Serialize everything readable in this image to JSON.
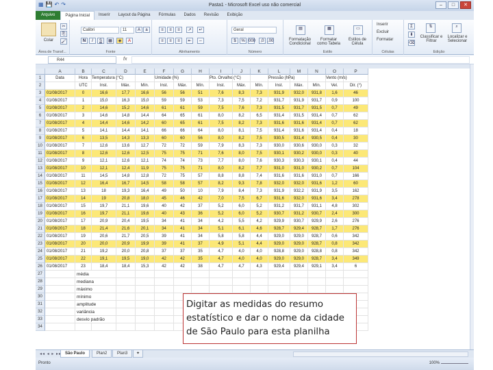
{
  "window": {
    "title": "Pasta1 - Microsoft Excel uso não comercial",
    "controls": [
      "–",
      "□",
      "✕"
    ]
  },
  "ribbon_tabs": [
    "Arquivo",
    "Página Inicial",
    "Inserir",
    "Layout da Página",
    "Fórmulas",
    "Dados",
    "Revisão",
    "Exibição"
  ],
  "ribbon": {
    "paste_label": "Colar",
    "font_name": "Calibri",
    "font_size": "11",
    "number_format": "Geral",
    "groups": [
      "Área de Transf...",
      "Fonte",
      "Alinhamento",
      "Número",
      "Estilo",
      "Células",
      "Edição"
    ],
    "style_buttons": [
      "Formatação Condicional",
      "Formatar como Tabela",
      "Estilos de Célula"
    ],
    "cell_buttons": [
      "Inserir",
      "Excluir",
      "Formatar"
    ],
    "edit_buttons": [
      "Classificar e Filtrar",
      "Localizar e Selecionar"
    ]
  },
  "formula_bar": {
    "name_box": "R44",
    "fx": "fx",
    "value": ""
  },
  "columns": [
    "A",
    "B",
    "C",
    "D",
    "E",
    "F",
    "G",
    "H",
    "I",
    "J",
    "K",
    "L",
    "M",
    "N",
    "O",
    "P"
  ],
  "header_row1": {
    "A": "Data",
    "B": "Hora",
    "C": "Temperatura (°C)",
    "F": "Umidade (%)",
    "I": "Pto. Orvalho (°C)",
    "L": "Pressão (hPa)",
    "O": "Vento (m/s)"
  },
  "header_row2": [
    "",
    "UTC",
    "Inst.",
    "Máx.",
    "Mín.",
    "Inst.",
    "Máx.",
    "Mín.",
    "Inst.",
    "Máx.",
    "Mín.",
    "Inst.",
    "Máx.",
    "Mín.",
    "Vel.",
    "Dir. (°)"
  ],
  "data_rows": [
    [
      "01/08/2017",
      "0",
      "16,6",
      "17,7",
      "16,6",
      "56",
      "56",
      "51",
      "7,6",
      "8,3",
      "7,3",
      "931,9",
      "932,0",
      "931,8",
      "1,6",
      "46"
    ],
    [
      "01/08/2017",
      "1",
      "15,0",
      "16,3",
      "15,0",
      "59",
      "59",
      "53",
      "7,3",
      "7,5",
      "7,2",
      "931,7",
      "931,9",
      "931,7",
      "0,9",
      "100"
    ],
    [
      "01/08/2017",
      "2",
      "14,6",
      "15,2",
      "14,6",
      "61",
      "61",
      "59",
      "7,5",
      "7,6",
      "7,3",
      "931,5",
      "931,7",
      "931,5",
      "0,7",
      "49"
    ],
    [
      "01/08/2017",
      "3",
      "14,6",
      "14,8",
      "14,4",
      "64",
      "65",
      "61",
      "8,0",
      "8,2",
      "6,5",
      "931,4",
      "931,5",
      "931,4",
      "0,7",
      "62"
    ],
    [
      "01/08/2017",
      "4",
      "14,4",
      "14,6",
      "14,2",
      "60",
      "65",
      "61",
      "7,5",
      "8,2",
      "7,3",
      "931,6",
      "931,6",
      "931,4",
      "0,7",
      "62"
    ],
    [
      "01/08/2017",
      "5",
      "14,1",
      "14,4",
      "14,1",
      "66",
      "66",
      "64",
      "8,0",
      "8,1",
      "7,5",
      "931,4",
      "931,6",
      "931,4",
      "0,4",
      "18"
    ],
    [
      "01/08/2017",
      "6",
      "13,5",
      "14,3",
      "13,3",
      "60",
      "60",
      "56",
      "8,0",
      "8,2",
      "7,5",
      "930,5",
      "931,4",
      "930,5",
      "0,4",
      "30"
    ],
    [
      "01/08/2017",
      "7",
      "12,6",
      "13,6",
      "12,7",
      "72",
      "72",
      "59",
      "7,9",
      "8,3",
      "7,3",
      "930,0",
      "930,6",
      "930,0",
      "0,3",
      "32"
    ],
    [
      "01/08/2017",
      "8",
      "12,6",
      "12,6",
      "12,5",
      "75",
      "75",
      "71",
      "7,6",
      "8,0",
      "7,5",
      "930,1",
      "930,2",
      "930,0",
      "0,3",
      "40"
    ],
    [
      "01/08/2017",
      "9",
      "12,1",
      "12,6",
      "12,1",
      "74",
      "74",
      "73",
      "7,7",
      "8,0",
      "7,6",
      "930,3",
      "930,3",
      "930,1",
      "0,4",
      "44"
    ],
    [
      "01/08/2017",
      "10",
      "12,1",
      "12,4",
      "11,9",
      "75",
      "75",
      "71",
      "8,0",
      "8,2",
      "7,7",
      "931,0",
      "931,0",
      "930,2",
      "0,7",
      "104"
    ],
    [
      "01/08/2017",
      "11",
      "14,5",
      "14,8",
      "12,8",
      "72",
      "75",
      "57",
      "8,8",
      "8,8",
      "7,4",
      "931,6",
      "931,6",
      "931,0",
      "0,7",
      "166"
    ],
    [
      "01/08/2017",
      "12",
      "16,4",
      "16,7",
      "14,5",
      "58",
      "58",
      "57",
      "8,2",
      "9,3",
      "7,8",
      "932,0",
      "932,0",
      "931,6",
      "1,2",
      "60"
    ],
    [
      "01/08/2017",
      "13",
      "18",
      "19,3",
      "16,4",
      "49",
      "50",
      "10",
      "7,9",
      "8,4",
      "7,3",
      "931,9",
      "932,2",
      "931,9",
      "3,5",
      "162"
    ],
    [
      "01/08/2017",
      "14",
      "19",
      "20,8",
      "18,0",
      "45",
      "46",
      "42",
      "7,0",
      "7,5",
      "6,7",
      "931,6",
      "932,0",
      "931,6",
      "3,4",
      "278"
    ],
    [
      "01/08/2017",
      "15",
      "19,7",
      "21,1",
      "19,6",
      "40",
      "42",
      "37",
      "5,2",
      "6,0",
      "5,2",
      "931,2",
      "931,7",
      "931,1",
      "4,8",
      "302"
    ],
    [
      "01/08/2017",
      "16",
      "19,7",
      "21,1",
      "19,6",
      "40",
      "43",
      "36",
      "5,2",
      "6,0",
      "5,2",
      "930,7",
      "931,2",
      "930,7",
      "2,4",
      "300"
    ],
    [
      "01/08/2017",
      "17",
      "20,9",
      "20,4",
      "19,5",
      "34",
      "41",
      "34",
      "4,2",
      "5,5",
      "4,2",
      "929,9",
      "930,7",
      "929,9",
      "2,6",
      "276"
    ],
    [
      "01/08/2017",
      "18",
      "21,4",
      "21,6",
      "20,1",
      "34",
      "41",
      "34",
      "5,1",
      "6,1",
      "4,6",
      "928,7",
      "929,4",
      "928,7",
      "1,7",
      "276"
    ],
    [
      "01/08/2017",
      "19",
      "20,6",
      "21,7",
      "20,5",
      "39",
      "41",
      "34",
      "5,8",
      "5,8",
      "4,4",
      "929,0",
      "929,0",
      "928,7",
      "0,6",
      "342"
    ],
    [
      "01/08/2017",
      "20",
      "20,0",
      "20,9",
      "19,9",
      "39",
      "41",
      "37",
      "4,9",
      "5,1",
      "4,4",
      "929,0",
      "929,0",
      "928,7",
      "0,8",
      "342"
    ],
    [
      "01/08/2017",
      "21",
      "19,2",
      "20,0",
      "20,8",
      "37",
      "37",
      "35",
      "4,7",
      "4,0",
      "4,0",
      "928,8",
      "929,0",
      "928,8",
      "0,8",
      "342"
    ],
    [
      "01/08/2017",
      "22",
      "19,1",
      "19,5",
      "19,0",
      "42",
      "42",
      "35",
      "4,7",
      "4,0",
      "4,0",
      "929,0",
      "929,0",
      "928,7",
      "3,4",
      "349"
    ],
    [
      "01/08/2017",
      "23",
      "18,4",
      "18,4",
      "15,3",
      "42",
      "42",
      "38",
      "4,7",
      "4,7",
      "4,3",
      "929,4",
      "929,4",
      "929,1",
      "3,4",
      "6"
    ]
  ],
  "stat_labels": [
    "média",
    "mediana",
    "máximo",
    "mínimo",
    "amplitude",
    "variância",
    "desvio padrão"
  ],
  "row_numbers": [
    "1",
    "2",
    "3",
    "4",
    "5",
    "6",
    "7",
    "8",
    "9",
    "10",
    "11",
    "12",
    "13",
    "14",
    "15",
    "16",
    "17",
    "18",
    "19",
    "20",
    "21",
    "22",
    "23",
    "24",
    "25",
    "26",
    "27",
    "28",
    "29",
    "30",
    "31",
    "32",
    "33",
    "34"
  ],
  "sheet_tabs": [
    "São Paulo",
    "Plan2",
    "Plan3"
  ],
  "status": {
    "ready": "Pronto",
    "zoom": "100%"
  },
  "annotation": "Digitar as medidas do resumo estatístico e dar o nome da cidade de São Paulo para esta planilha",
  "colors": {
    "highlight": "#fce877",
    "file_tab": "#2e7d32",
    "annotation_border": "#bb3333"
  }
}
